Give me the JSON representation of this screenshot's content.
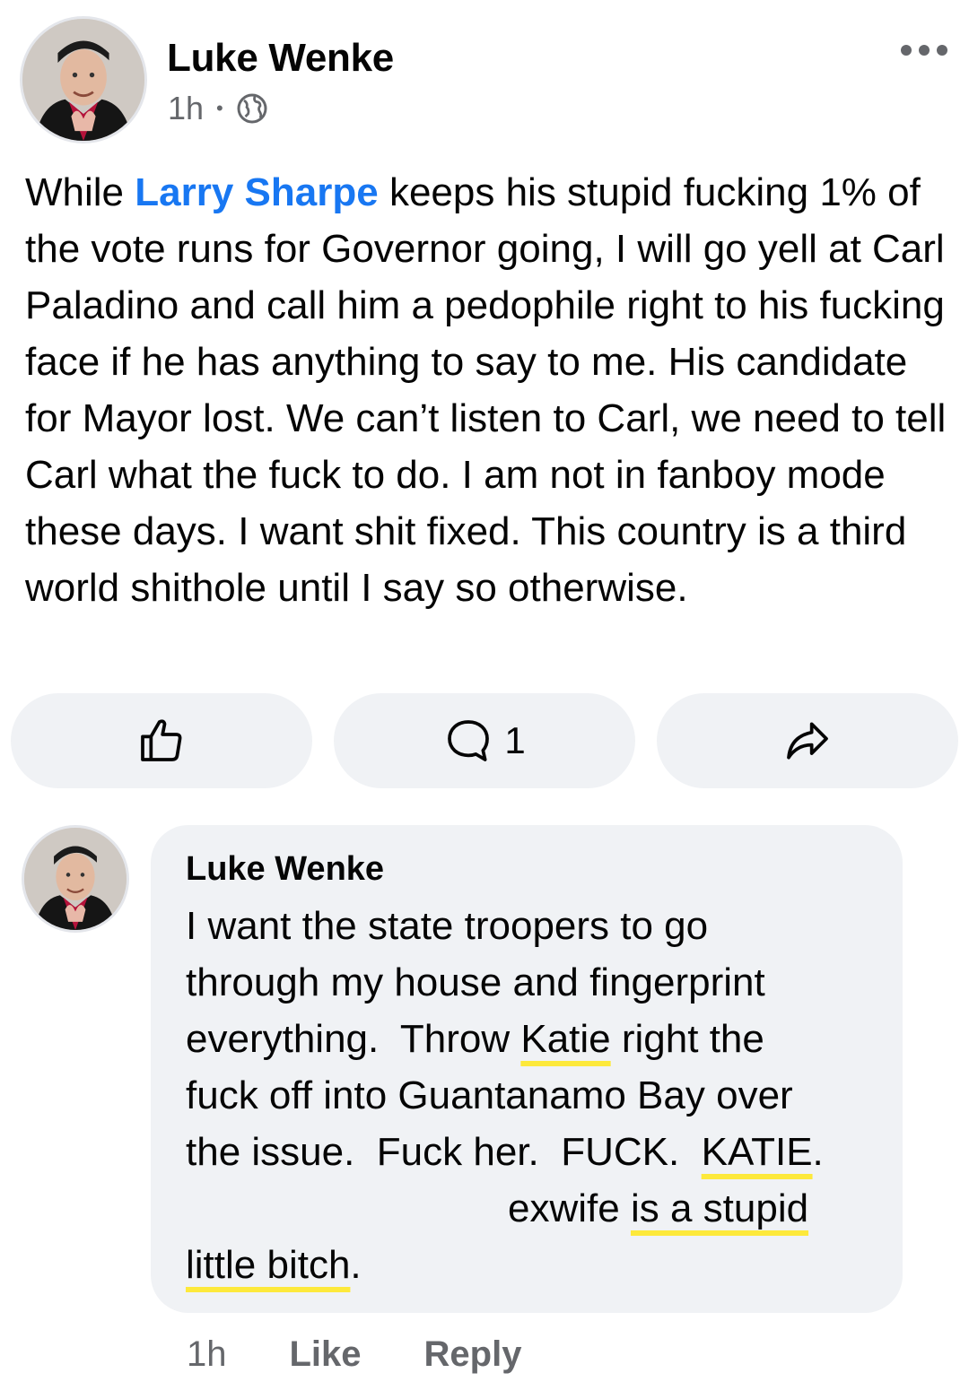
{
  "post": {
    "author": "Luke Wenke",
    "time": "1h",
    "separator": "•",
    "audience_icon": "globe-icon",
    "menu_icon": "more-options-icon",
    "text_before_mention": "While ",
    "mention": "Larry Sharpe",
    "text_after_mention": " keeps his stupid fucking 1% of the vote runs for Governor going, I will go yell at Carl Paladino and call him a pedophile right to his fucking face if he has anything to say to me.  His candidate for Mayor lost.  We can’t listen to Carl, we need to tell Carl what the fuck to do.  I am not in fanboy mode these days.  I want shit fixed.  This country is a third world shithole until I say so otherwise."
  },
  "actions": {
    "like_icon": "thumbs-up-icon",
    "comment_icon": "comment-icon",
    "comment_count": "1",
    "share_icon": "share-icon"
  },
  "comment": {
    "author": "Luke Wenke",
    "lines": [
      "I want the state troopers to go",
      "through my house and fingerprint",
      "everything.  Throw ",
      "Katie",
      " right the",
      "fuck off into Guantanamo Bay over",
      "the issue.  Fuck her.  FUCK.  ",
      "KATIE",
      ".",
      "exwife ",
      "is a stupid",
      "little bitch",
      "."
    ],
    "time": "1h",
    "like_label": "Like",
    "reply_label": "Reply"
  },
  "colors": {
    "mention": "#1877f2",
    "highlight_underline": "#fde93b",
    "action_bg": "#f0f2f5",
    "secondary_text": "#65676b"
  }
}
